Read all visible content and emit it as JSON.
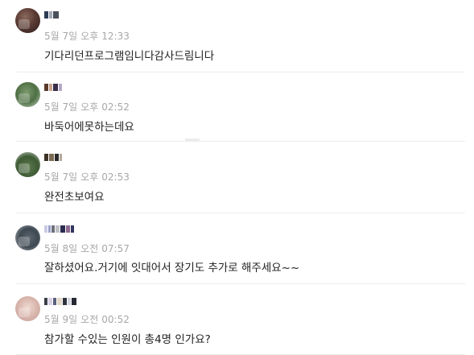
{
  "comments": [
    {
      "author": "",
      "date": "5월 7일",
      "ampm": "오후",
      "time": "12:33",
      "text": "기다리던프로그램임니다감사드림니다"
    },
    {
      "author": "",
      "date": "5월 7일",
      "ampm": "오후",
      "time": "02:52",
      "text": "바둑어에못하는데요"
    },
    {
      "author": "",
      "date": "5월 7일",
      "ampm": "오후",
      "time": "02:53",
      "text": "완전초보여요"
    },
    {
      "author": "",
      "date": "5월 8일",
      "ampm": "오전",
      "time": "07:57",
      "text": "잘하셨어요.거기에 잇대어서 장기도 추가로 해주세요~~"
    },
    {
      "author": "",
      "date": "5월 9일",
      "ampm": "오전",
      "time": "00:52",
      "text": "참가할 수있는 인원이 총4명 인가요?"
    }
  ],
  "icons": {
    "avatar": "profile-photo-blurred"
  }
}
